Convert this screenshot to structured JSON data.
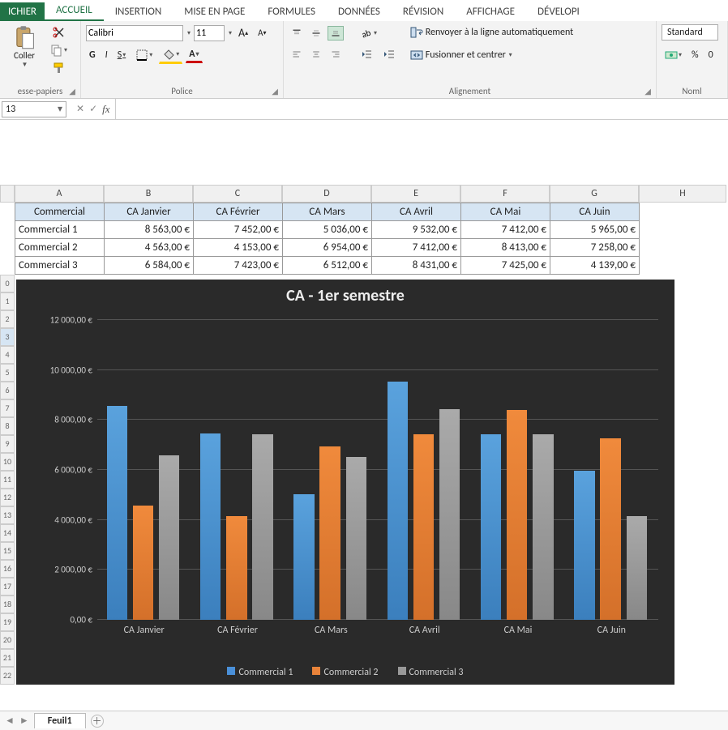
{
  "tabs": {
    "file": "ICHIER",
    "items": [
      "ACCUEIL",
      "INSERTION",
      "MISE EN PAGE",
      "FORMULES",
      "DONNÉES",
      "RÉVISION",
      "AFFICHAGE",
      "DÉVELOPI"
    ],
    "active": 0
  },
  "ribbon": {
    "clipboard": {
      "paste": "Coller",
      "group": "esse-papiers"
    },
    "font": {
      "name": "Calibri",
      "size": "11",
      "bold": "G",
      "italic": "I",
      "underline": "S",
      "group": "Police"
    },
    "align": {
      "wrap": "Renvoyer à la ligne automatiquement",
      "merge": "Fusionner et centrer",
      "group": "Alignement"
    },
    "number": {
      "format": "Standard",
      "pct": "%",
      "th": "0",
      "group": "Noml"
    }
  },
  "namebox": "13",
  "fx": "fx",
  "columns": [
    "A",
    "B",
    "C",
    "D",
    "E",
    "F",
    "G",
    "H"
  ],
  "table": {
    "headers": [
      "Commercial",
      "CA Janvier",
      "CA Février",
      "CA Mars",
      "CA Avril",
      "CA Mai",
      "CA Juin"
    ],
    "rows": [
      {
        "label": "Commercial 1",
        "vals": [
          "8 563,00 €",
          "7 452,00 €",
          "5 036,00 €",
          "9 532,00 €",
          "7 412,00 €",
          "5 965,00 €"
        ]
      },
      {
        "label": "Commercial 2",
        "vals": [
          "4 563,00 €",
          "4 153,00 €",
          "6 954,00 €",
          "7 412,00 €",
          "8 413,00 €",
          "7 258,00 €"
        ]
      },
      {
        "label": "Commercial 3",
        "vals": [
          "6 584,00 €",
          "7 423,00 €",
          "6 512,00 €",
          "8 431,00 €",
          "7 425,00 €",
          "4 139,00 €"
        ]
      }
    ]
  },
  "chart_data": {
    "type": "bar",
    "title": "CA - 1er semestre",
    "ylabel": "",
    "ylim": [
      0,
      12000
    ],
    "yticks": [
      "0,00 €",
      "2 000,00 €",
      "4 000,00 €",
      "6 000,00 €",
      "8 000,00 €",
      "10 000,00 €",
      "12 000,00 €"
    ],
    "categories": [
      "CA Janvier",
      "CA Février",
      "CA Mars",
      "CA Avril",
      "CA Mai",
      "CA Juin"
    ],
    "series": [
      {
        "name": "Commercial 1",
        "values": [
          8563,
          7452,
          5036,
          9532,
          7412,
          5965
        ]
      },
      {
        "name": "Commercial 2",
        "values": [
          4563,
          4153,
          6954,
          7412,
          8413,
          7258
        ]
      },
      {
        "name": "Commercial 3",
        "values": [
          6584,
          7423,
          6512,
          8431,
          7425,
          4139
        ]
      }
    ]
  },
  "rownums_start": 0,
  "sheet": {
    "name": "Feuil1"
  }
}
